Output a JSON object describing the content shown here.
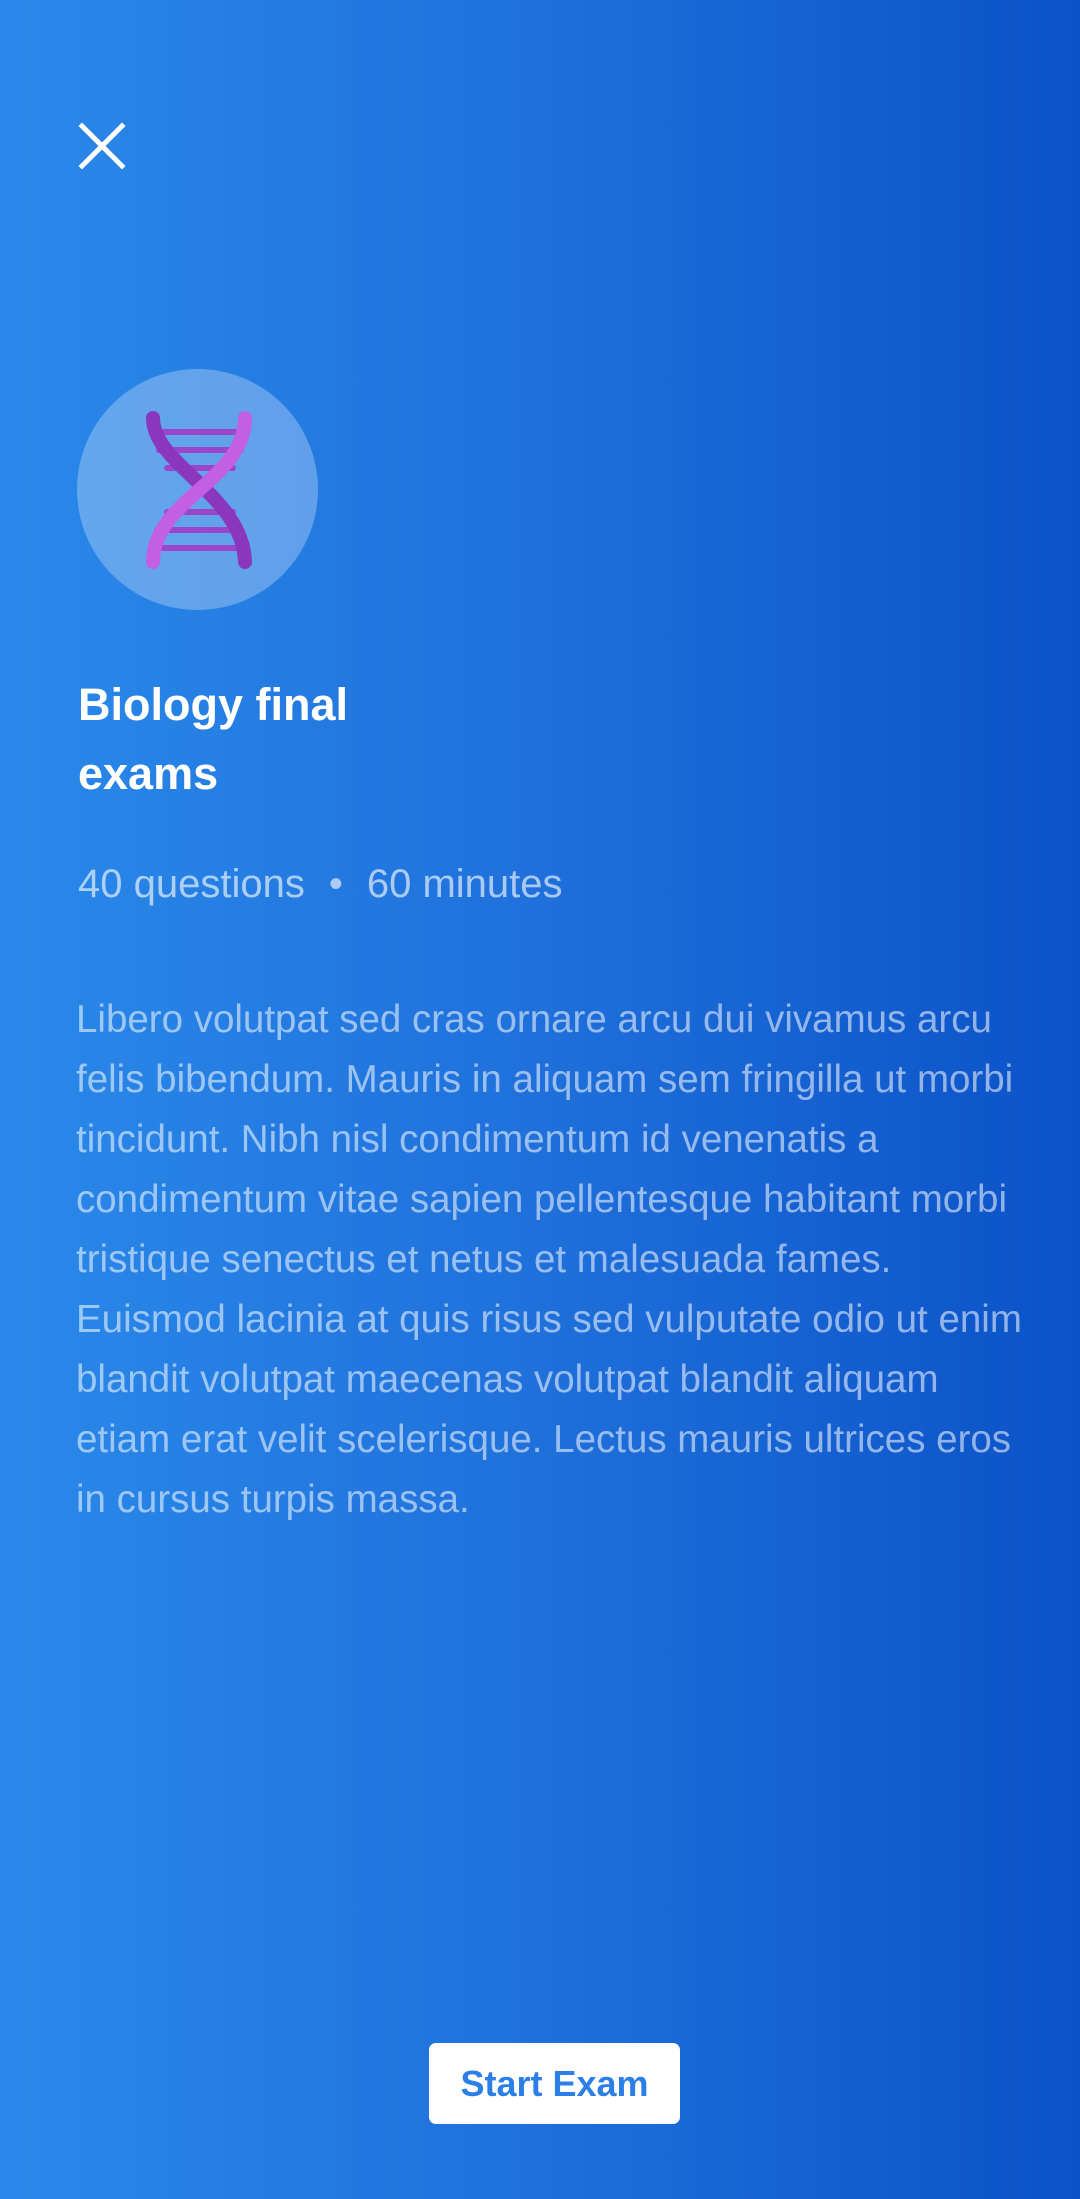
{
  "header": {
    "close_icon": "close-icon"
  },
  "exam": {
    "icon": "dna-icon",
    "title": "Biology final exams",
    "questions": "40 questions",
    "separator": "•",
    "duration": "60 minutes",
    "description": "Libero volutpat sed cras ornare arcu dui vivamus arcu felis bibendum. Mauris in aliquam sem fringilla ut morbi tincidunt. Nibh nisl condimentum id venenatis a condimentum vitae sapien pellentesque habitant morbi tristique senectus et netus et malesuada fames. Euismod lacinia at quis risus sed vulputate odio ut enim blandit volutpat maecenas volutpat blandit aliquam etiam erat velit scelerisque. Lectus mauris ultrices eros in cursus turpis massa."
  },
  "actions": {
    "start_label": "Start Exam"
  },
  "colors": {
    "background_start": "#2a89ea",
    "background_end": "#0b52c8",
    "dna_primary": "#b04fd8",
    "dna_secondary": "#8e3bbf",
    "button_text": "#2b7fe6"
  }
}
